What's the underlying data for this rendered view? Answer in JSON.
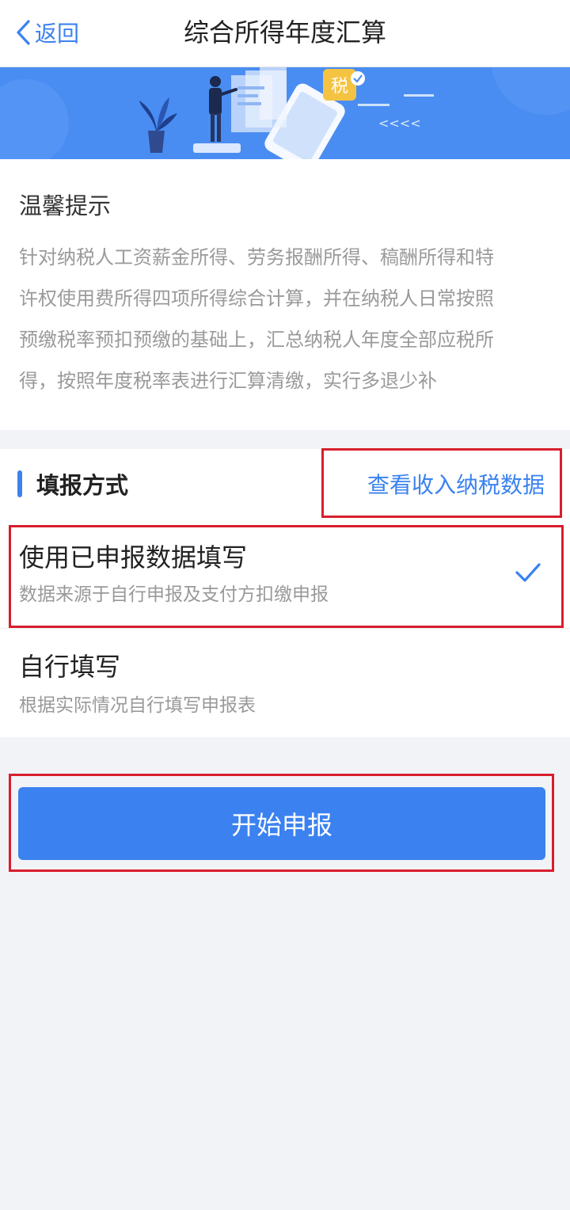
{
  "navbar": {
    "back_label": "返回",
    "title": "综合所得年度汇算"
  },
  "banner": {
    "badge_text": "税",
    "arrows_text": "<<<<"
  },
  "notice": {
    "title": "温馨提示",
    "lines": [
      "针对纳税人工资薪金所得、劳务报酬所得、稿酬所得和特",
      "许权使用费所得四项所得综合计算，并在纳税人日常按照",
      "预缴税率预扣预缴的基础上，汇总纳税人年度全部应税所",
      "得，按照年度税率表进行汇算清缴，实行多退少补"
    ]
  },
  "method": {
    "section_title": "填报方式",
    "view_link": "查看收入纳税数据",
    "options": [
      {
        "title": "使用已申报数据填写",
        "subtitle": "数据来源于自行申报及支付方扣缴申报",
        "selected": true
      },
      {
        "title": "自行填写",
        "subtitle": "根据实际情况自行填写申报表",
        "selected": false
      }
    ]
  },
  "submit": {
    "label": "开始申报"
  },
  "colors": {
    "accent": "#3b82f0",
    "banner": "#4a8df2",
    "highlight": "#d81e2c"
  }
}
